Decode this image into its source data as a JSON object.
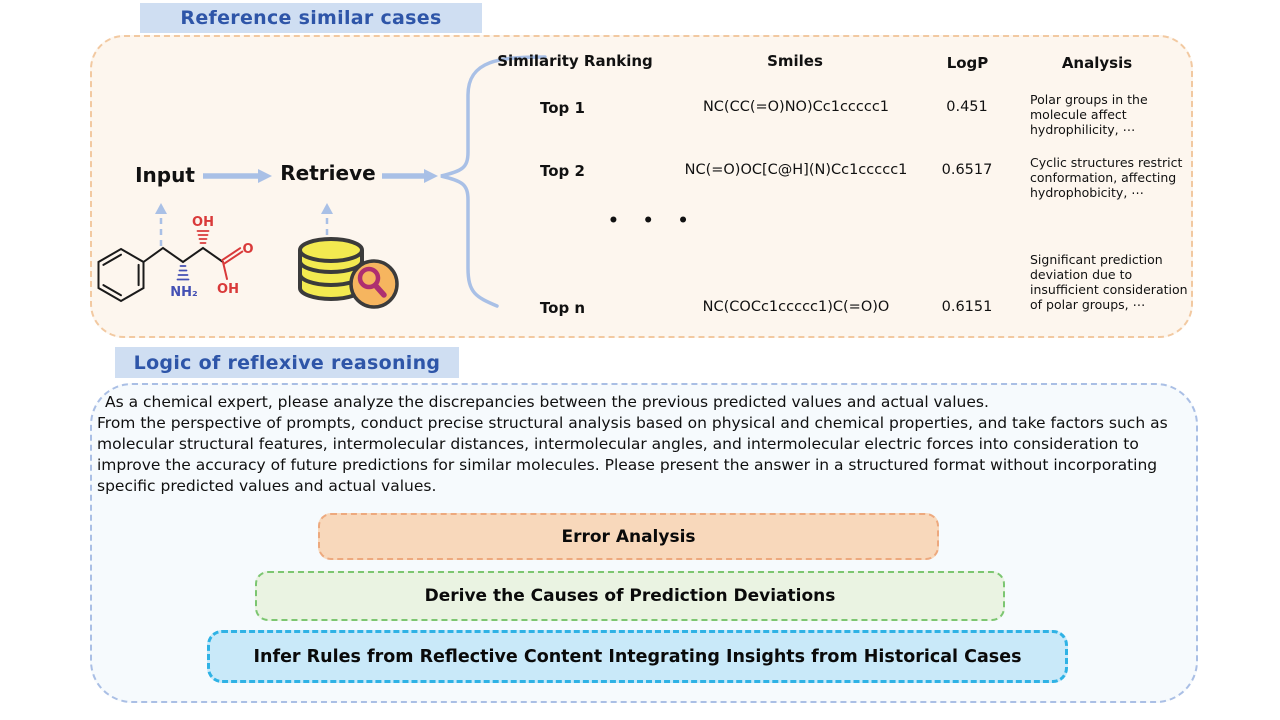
{
  "reference": {
    "title": "Reference similar cases",
    "flow": {
      "input_label": "Input",
      "retrieve_label": "Retrieve"
    },
    "molecule_labels": {
      "hydroxyl_top": "OH",
      "amine": "NH₂",
      "carbonyl_oxygen": "O",
      "acid_hydroxyl": "OH"
    },
    "table": {
      "headers": {
        "ranking": "Similarity Ranking",
        "smiles": "Smiles",
        "logp": "LogP",
        "analysis": "Analysis"
      },
      "rows": [
        {
          "rank": "Top 1",
          "smiles": "NC(CC(=O)NO)Cc1ccccc1",
          "logp": "0.451",
          "analysis": "Polar groups in the molecule affect hydrophilicity, ⋯"
        },
        {
          "rank": "Top 2",
          "smiles": "NC(=O)OC[C@H](N)Cc1ccccc1",
          "logp": "0.6517",
          "analysis": "Cyclic structures restrict conformation, affecting hydrophobicity, ⋯"
        },
        {
          "rank": "Top n",
          "smiles": "NC(COCc1ccccc1)C(=O)O",
          "logp": "0.6151",
          "analysis": "Significant prediction deviation due to insufficient consideration of polar groups, ⋯"
        }
      ],
      "ellipsis": "• • •"
    }
  },
  "reasoning": {
    "title": "Logic of reflexive reasoning",
    "prompt": "As a chemical expert, please analyze the discrepancies between the previous predicted values and actual values.\nFrom the perspective of prompts, conduct precise structural analysis based on physical and chemical properties, and take factors such as molecular structural features, intermolecular distances, intermolecular angles, and intermolecular electric forces into consideration to improve the accuracy of future predictions for similar molecules. Please present the answer in a structured format without incorporating specific predicted values and actual values.",
    "steps": [
      {
        "label": "Error Analysis"
      },
      {
        "label": "Derive the Causes of Prediction Deviations"
      },
      {
        "label": "Infer Rules from Reflective Content Integrating Insights from Historical Cases"
      }
    ]
  },
  "colors": {
    "badge_bg": "#cfdef2",
    "badge_text": "#2e55a8",
    "panel_top_bg": "#fdf6ee",
    "panel_top_border": "#f2c9a1",
    "panel_bottom_bg": "#f6fafd",
    "panel_bottom_border": "#aabfe5",
    "arrow_blue": "#a9c0e6",
    "step_error_bg": "#f8d8bb",
    "step_error_border": "#eda97e",
    "step_derive_bg": "#eaf3e2",
    "step_derive_border": "#7cc671",
    "step_infer_bg": "#c9e9f9",
    "step_infer_border": "#2fb2e5",
    "database_yellow": "#f3ea50",
    "magnifier_orange": "#f6b55f",
    "magnifier_glass": "#ae2f70",
    "bond_red": "#d93a3a",
    "bond_blue": "#4450b4"
  }
}
